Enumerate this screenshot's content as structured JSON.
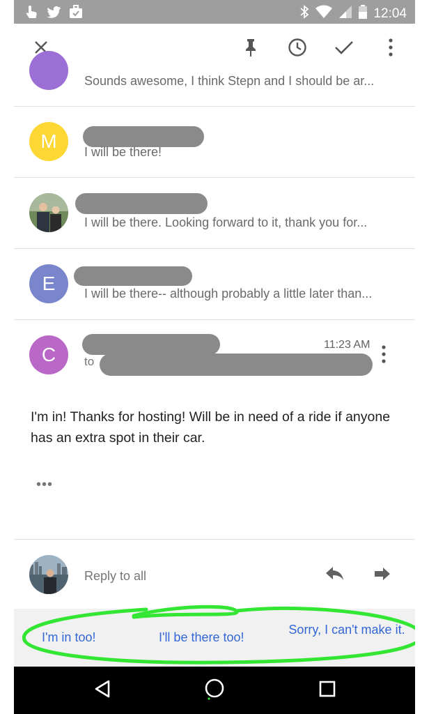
{
  "status_bar": {
    "time": "12:04",
    "left_icons": [
      "touch-icon",
      "twitter-icon",
      "briefcase-check-icon"
    ],
    "right_icons": [
      "bluetooth-icon",
      "wifi-icon",
      "signal-icon",
      "battery-icon"
    ]
  },
  "toolbar": {
    "close_icon": "close-icon",
    "actions": [
      "pin-icon",
      "snooze-clock-icon",
      "done-check-icon",
      "more-vert-icon"
    ]
  },
  "thread": {
    "messages": [
      {
        "avatar_letter": "",
        "avatar_color": "#9c6fd6",
        "snippet": "Sounds awesome, I think Stepn and I should be ar..."
      },
      {
        "avatar_letter": "M",
        "avatar_color": "#fdd835",
        "snippet": "I will be there!"
      },
      {
        "avatar_letter": "",
        "avatar_color": "#5b6b6e",
        "snippet": "I will be there. Looking forward to it, thank you for..."
      },
      {
        "avatar_letter": "E",
        "avatar_color": "#7986cb",
        "snippet": "I will be there-- although probably a little later than..."
      }
    ],
    "expanded": {
      "avatar_letter": "C",
      "avatar_color": "#ba68c8",
      "time": "11:23 AM",
      "to_prefix": "to",
      "body": "I'm in! Thanks for hosting! Will be in need of a ride if anyone has an extra spot in their car.",
      "more": "•••"
    }
  },
  "reply": {
    "label": "Reply to all"
  },
  "smart_replies": [
    "I'm in too!",
    "I'll be there too!",
    "Sorry, I can't make it."
  ],
  "colors": {
    "accent": "#3367d6",
    "highlight": "#33e633",
    "statusbar": "#9e9e9e"
  }
}
